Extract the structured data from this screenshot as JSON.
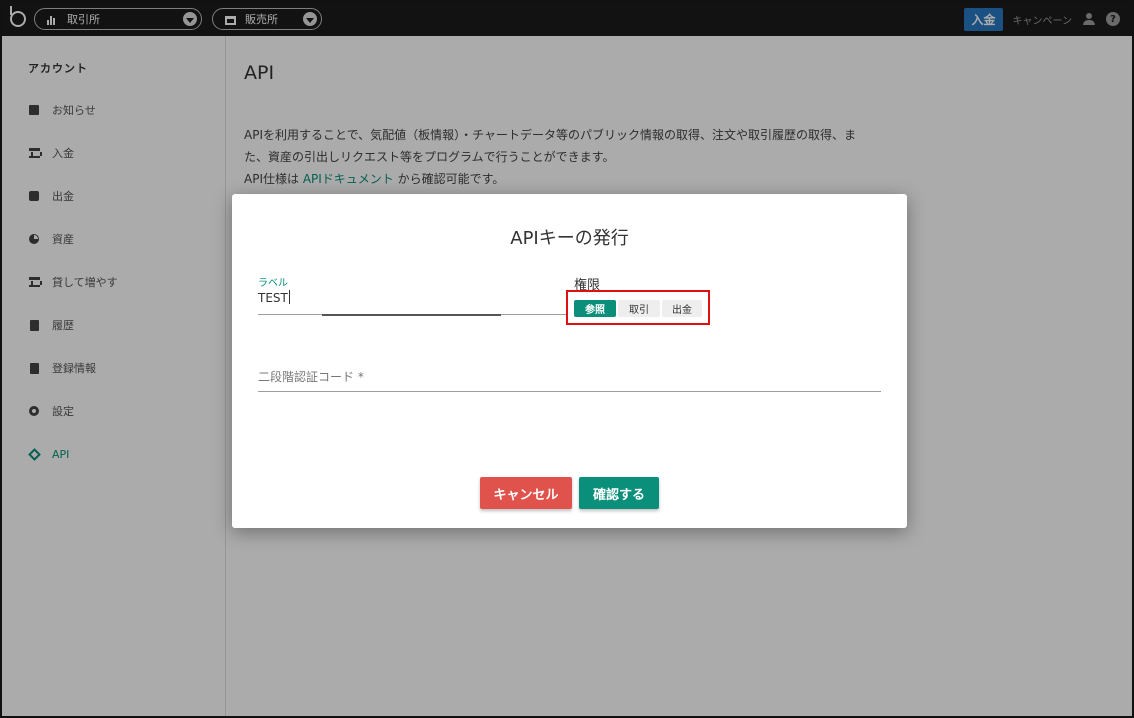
{
  "topbar": {
    "exchange_label": "取引所",
    "store_label": "販売所",
    "deposit_label": "入金",
    "campaign_label": "キャンペーン"
  },
  "sidebar": {
    "title": "アカウント",
    "items": [
      {
        "label": "お知らせ",
        "icon": "message-icon"
      },
      {
        "label": "入金",
        "icon": "bank-icon"
      },
      {
        "label": "出金",
        "icon": "wallet-icon"
      },
      {
        "label": "資産",
        "icon": "pie-chart-icon"
      },
      {
        "label": "貸して増やす",
        "icon": "bank-icon"
      },
      {
        "label": "履歴",
        "icon": "clipboard-icon"
      },
      {
        "label": "登録情報",
        "icon": "id-card-icon"
      },
      {
        "label": "設定",
        "icon": "gear-icon"
      },
      {
        "label": "API",
        "icon": "api-icon",
        "active": true
      }
    ]
  },
  "main": {
    "title": "API",
    "desc_line1": "APIを利用することで、気配値（板情報）・チャートデータ等のパブリック情報の取得、注文や取引履歴の取得、ま",
    "desc_line2": "た、資産の引出しリクエスト等をプログラムで行うことができます。",
    "desc_line3_prefix": "API仕様は ",
    "desc_line3_link": "APIドキュメント",
    "desc_line3_suffix": " から確認可能です。"
  },
  "dialog": {
    "title": "APIキーの発行",
    "label_field_label": "ラベル",
    "label_field_value": "TEST",
    "permission_label": "権限",
    "permissions": [
      {
        "label": "参照",
        "selected": true
      },
      {
        "label": "取引",
        "selected": false
      },
      {
        "label": "出金",
        "selected": false
      }
    ],
    "twofa_placeholder": "二段階認証コード *",
    "cancel_label": "キャンセル",
    "confirm_label": "確認する"
  },
  "colors": {
    "accent": "#0a8f7a",
    "cancel": "#e0524c",
    "deposit": "#2979c2",
    "highlight_box": "#e01010"
  }
}
